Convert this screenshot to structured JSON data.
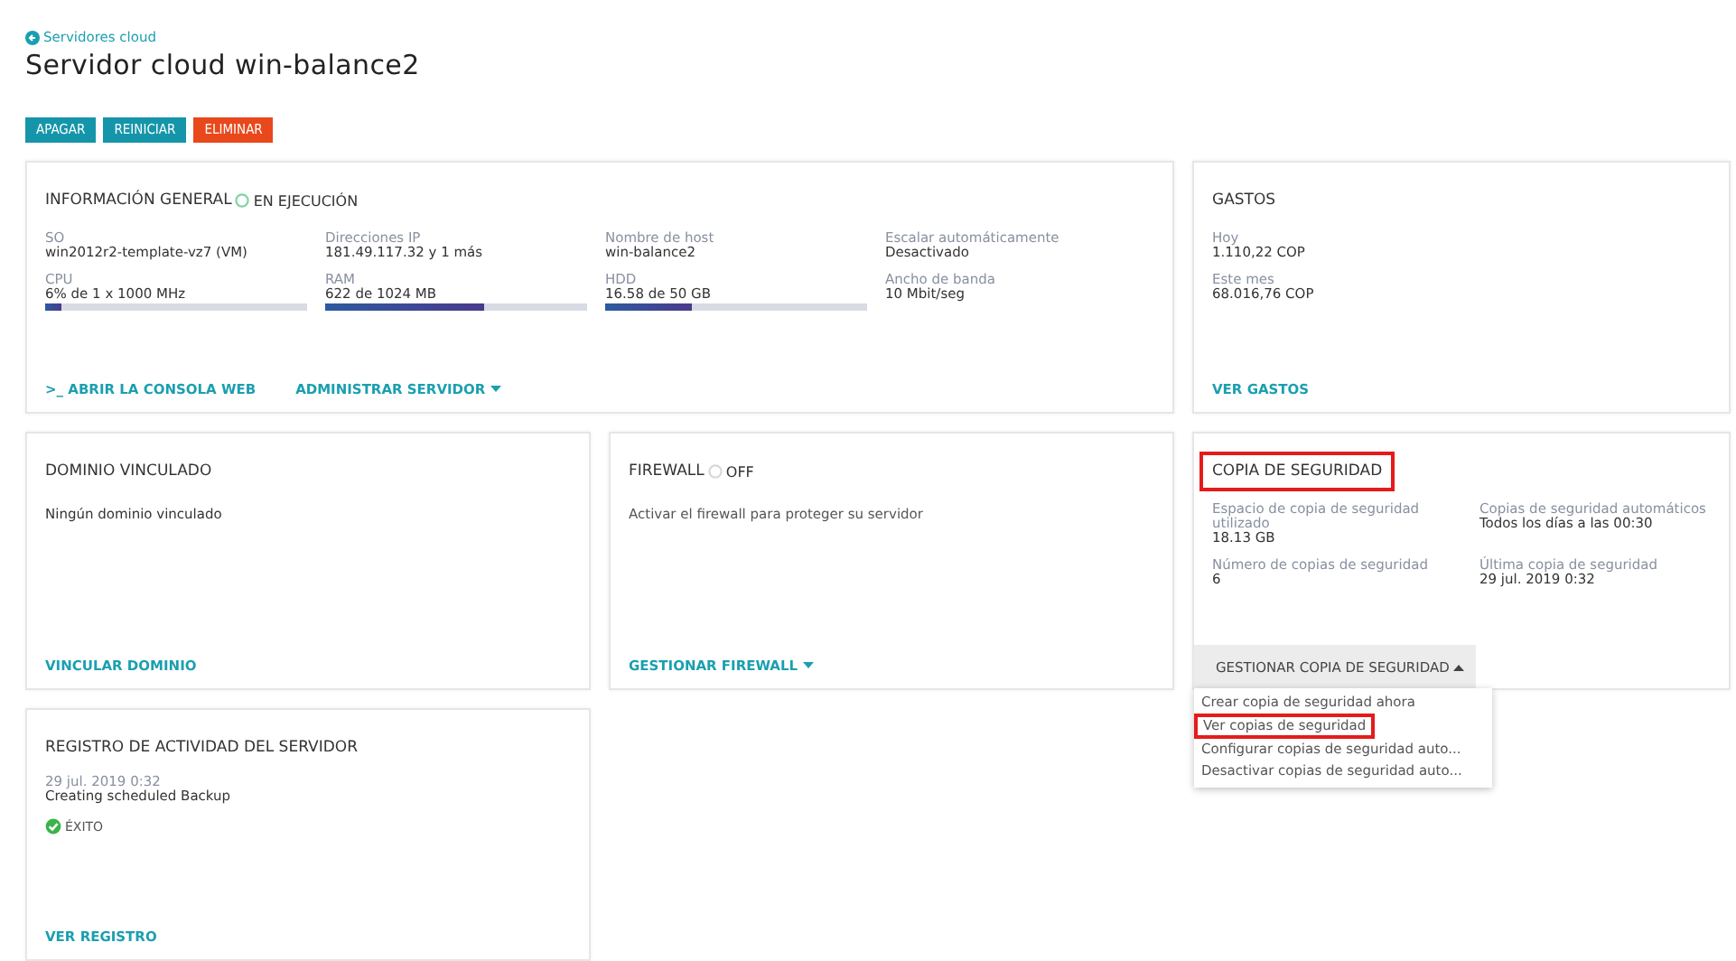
{
  "breadcrumb": "Servidores cloud",
  "title": "Servidor cloud win-balance2",
  "actions": [
    {
      "label": "APAGAR",
      "kind": "primary"
    },
    {
      "label": "REINICIAR",
      "kind": "primary"
    },
    {
      "label": "ELIMINAR",
      "kind": "danger"
    }
  ],
  "general": {
    "title": "INFORMACIÓN GENERAL",
    "status": "EN EJECUCIÓN",
    "fields": [
      {
        "label": "SO",
        "value": "win2012r2-template-vz7 (VM)"
      },
      {
        "label": "Direcciones IP",
        "value": "181.49.117.32 y 1 más"
      },
      {
        "label": "Nombre de host",
        "value": "win-balance2"
      },
      {
        "label": "Escalar automáticamente",
        "value": "Desactivado"
      },
      {
        "label": "CPU",
        "value": "6% de 1 x 1000 MHz",
        "level": 0.06
      },
      {
        "label": "RAM",
        "value": "622 de 1024 MB",
        "level": 0.61
      },
      {
        "label": "HDD",
        "value": "16.58 de 50 GB",
        "level": 0.33
      },
      {
        "label": "Ancho de banda",
        "value": "10 Mbit/seg"
      }
    ],
    "links": [
      {
        "label": ">_ ABRIR LA CONSOLA WEB",
        "dropdown": false
      },
      {
        "label": "ADMINISTRAR SERVIDOR",
        "dropdown": true
      }
    ]
  },
  "costs": {
    "title": "GASTOS",
    "fields": [
      {
        "label": "Hoy",
        "value": "1.110,22 COP"
      },
      {
        "label": "Este mes",
        "value": "68.016,76 COP"
      }
    ],
    "link": "VER GASTOS"
  },
  "domain": {
    "title": "DOMINIO VINCULADO",
    "text": "Ningún dominio vinculado",
    "link": "VINCULAR DOMINIO"
  },
  "firewall": {
    "title": "FIREWALL",
    "status": "OFF",
    "text": "Activar el firewall para proteger su servidor",
    "link": {
      "label": "GESTIONAR FIREWALL",
      "dropdown": true
    }
  },
  "backup": {
    "title": "COPIA DE SEGURIDAD",
    "highlighted": true,
    "fields": [
      {
        "label": "Espacio de copia de seguridad utilizado",
        "value": "18.13 GB"
      },
      {
        "label": "Copias de seguridad automáticos",
        "value": "Todos los días a las 00:30"
      },
      {
        "label": "Número de copias de seguridad",
        "value": "6"
      },
      {
        "label": "Última copia de seguridad",
        "value": "29 jul. 2019 0:32"
      }
    ],
    "menu_button": {
      "label": "GESTIONAR COPIA DE SEGURIDAD",
      "expanded": true
    },
    "menu": [
      {
        "label": "Crear copia de seguridad ahora",
        "highlighted": false
      },
      {
        "label": "Ver copias de seguridad",
        "highlighted": true
      },
      {
        "label": "Configurar copias de seguridad auto...",
        "highlighted": false
      },
      {
        "label": "Desactivar copias de seguridad auto...",
        "highlighted": false
      }
    ]
  },
  "activity": {
    "title": "REGISTRO DE ACTIVIDAD DEL SERVIDOR",
    "date": "29 jul. 2019 0:32",
    "event": "Creating scheduled Backup",
    "result": "ÉXITO",
    "link": "VER REGISTRO"
  }
}
